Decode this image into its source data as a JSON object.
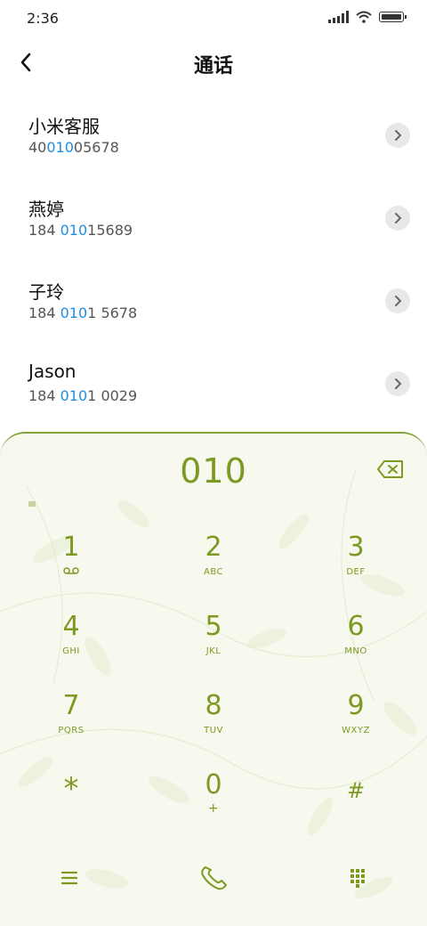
{
  "status_bar": {
    "time": "2:36"
  },
  "header": {
    "title": "通话"
  },
  "contacts": [
    {
      "name": "小米客服",
      "num_pre": "40",
      "num_hl": "010",
      "num_post": "05678"
    },
    {
      "name": "燕婷",
      "num_pre": "184 ",
      "num_hl": "010",
      "num_post": "15689"
    },
    {
      "name": "子玲",
      "num_pre": "184 ",
      "num_hl": "010",
      "num_post": "1 5678"
    },
    {
      "name": "Jason",
      "num_pre": "184 ",
      "num_hl": "010",
      "num_post": "1 0029"
    }
  ],
  "dialer": {
    "display": "010",
    "keys": [
      {
        "digit": "1",
        "letters": ""
      },
      {
        "digit": "2",
        "letters": "ABC"
      },
      {
        "digit": "3",
        "letters": "DEF"
      },
      {
        "digit": "4",
        "letters": "GHI"
      },
      {
        "digit": "5",
        "letters": "JKL"
      },
      {
        "digit": "6",
        "letters": "MNO"
      },
      {
        "digit": "7",
        "letters": "PQRS"
      },
      {
        "digit": "8",
        "letters": "TUV"
      },
      {
        "digit": "9",
        "letters": "WXYZ"
      },
      {
        "digit": "*",
        "letters": ""
      },
      {
        "digit": "0",
        "letters": "+"
      },
      {
        "digit": "#",
        "letters": ""
      }
    ]
  },
  "colors": {
    "accent": "#7c9a22",
    "highlight": "#1e8ee0"
  }
}
